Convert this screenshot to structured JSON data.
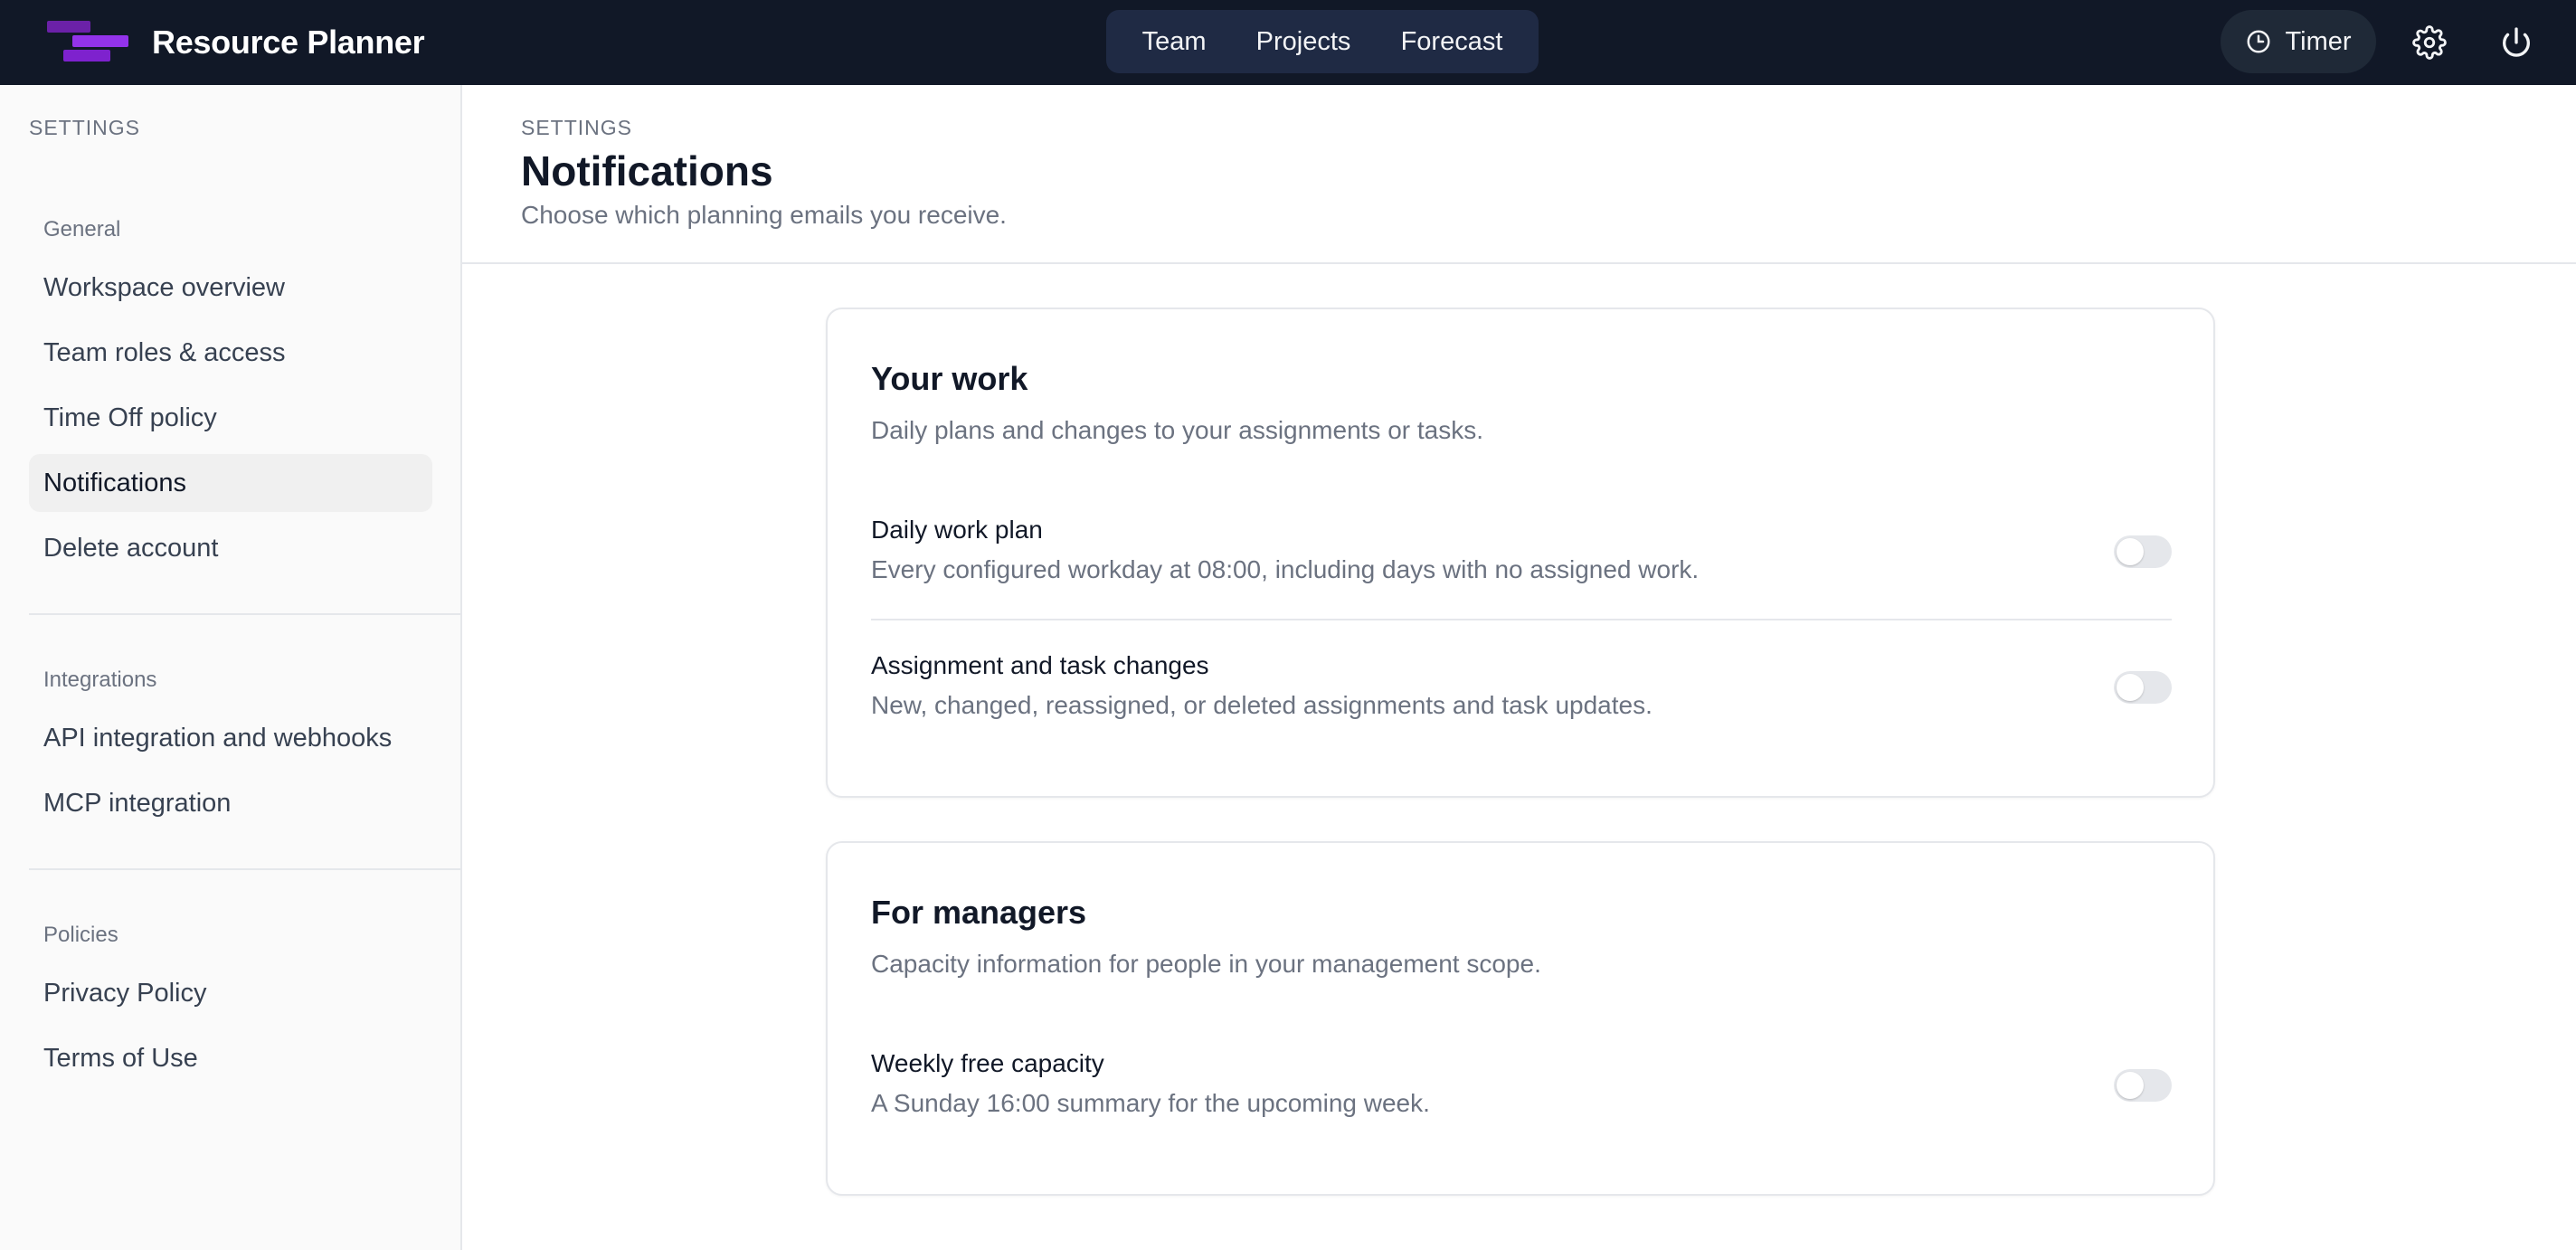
{
  "app": {
    "name": "Resource Planner"
  },
  "nav": {
    "items": [
      {
        "label": "Team"
      },
      {
        "label": "Projects"
      },
      {
        "label": "Forecast"
      }
    ],
    "timer_label": "Timer",
    "icons": {
      "timer": "clock-icon",
      "settings": "gear-icon",
      "logout": "power-icon"
    }
  },
  "sidebar": {
    "heading": "SETTINGS",
    "groups": [
      {
        "title": "General",
        "items": [
          "Workspace overview",
          "Team roles & access",
          "Time Off policy",
          "Notifications",
          "Delete account"
        ]
      },
      {
        "title": "Integrations",
        "items": [
          "API integration and webhooks",
          "MCP integration"
        ]
      },
      {
        "title": "Policies",
        "items": [
          "Privacy Policy",
          "Terms of Use"
        ]
      }
    ],
    "active_item": "Notifications"
  },
  "header": {
    "eyebrow": "SETTINGS",
    "title": "Notifications",
    "subtitle": "Choose which planning emails you receive."
  },
  "sections": [
    {
      "title": "Your work",
      "description": "Daily plans and changes to your assignments or tasks.",
      "settings": [
        {
          "title": "Daily work plan",
          "description": "Every configured workday at 08:00, including days with no assigned work.",
          "enabled": false
        },
        {
          "title": "Assignment and task changes",
          "description": "New, changed, reassigned, or deleted assignments and task updates.",
          "enabled": false
        }
      ]
    },
    {
      "title": "For managers",
      "description": "Capacity information for people in your management scope.",
      "settings": [
        {
          "title": "Weekly free capacity",
          "description": "A Sunday 16:00 summary for the upcoming week.",
          "enabled": false
        }
      ]
    }
  ],
  "colors": {
    "topbar": "#111827",
    "brand_purple": "#9333ea",
    "toggle_off": "#e5e7eb"
  }
}
